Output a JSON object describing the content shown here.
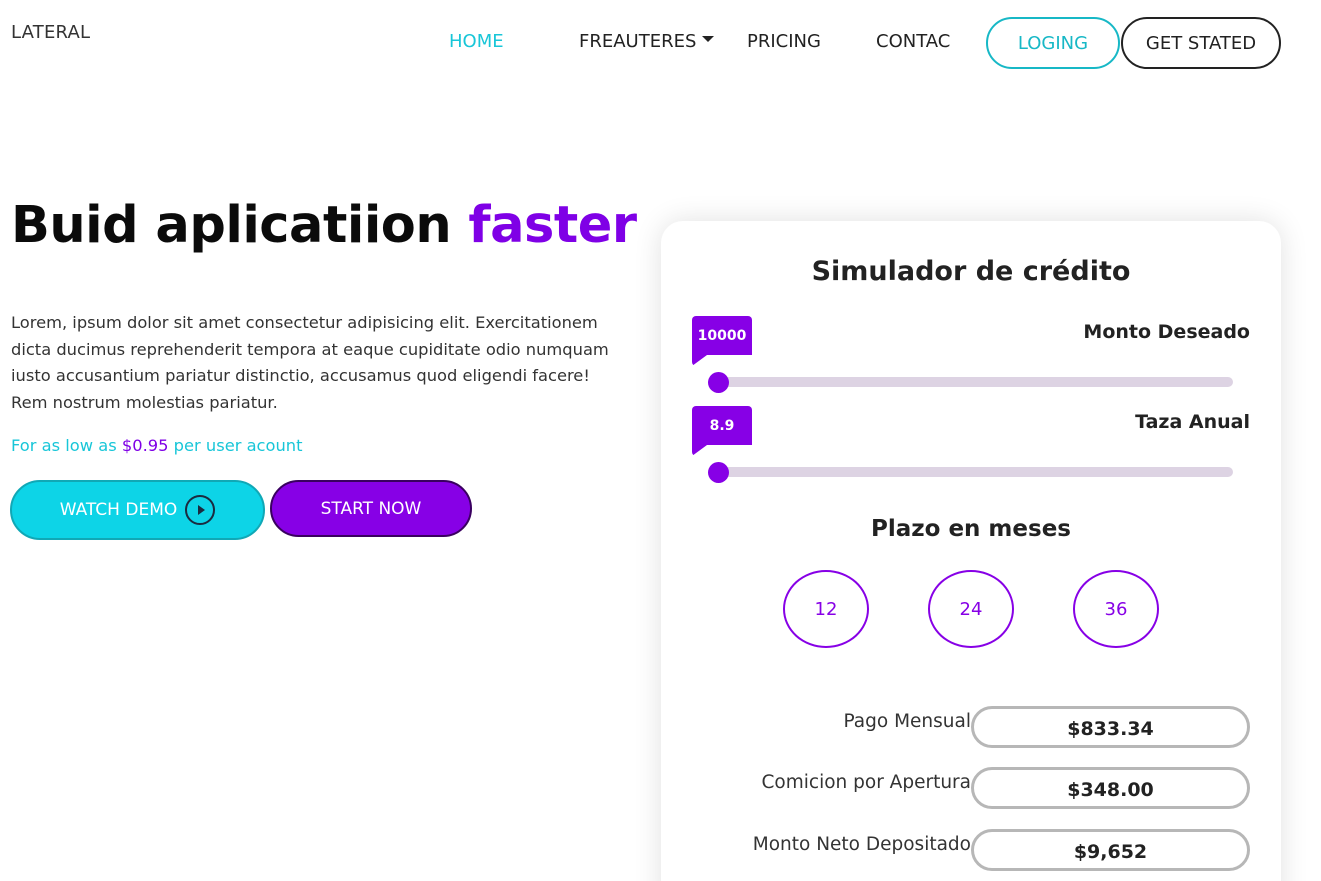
{
  "nav": {
    "brand": "LATERAL",
    "links": [
      "HOME",
      "FREAUTERES",
      "PRICING",
      "CONTAC"
    ],
    "login": "LOGING",
    "get_started": "GET STATED"
  },
  "hero": {
    "title_main": "Buid aplicatiion ",
    "title_accent": "faster",
    "description": "Lorem, ipsum dolor sit amet consectetur adipisicing elit. Exercitationem dicta ducimus reprehenderit tempora at eaque cupiditate odio numquam iusto accusantium pariatur distinctio, accusamus quod eligendi facere! Rem nostrum molestias pariatur.",
    "price_prefix": "For as low as ",
    "price_amount": "$0.95",
    "price_suffix": " per user acount",
    "watch_demo": "WATCH DEMO",
    "start_now": "START NOW"
  },
  "simulator": {
    "title": "Simulador de crédito",
    "amount_label": "Monto Deseado",
    "amount_value": "10000",
    "amount_position": 0,
    "rate_label": "Taza Anual",
    "rate_value": "8.9",
    "rate_position": 0,
    "term_title": "Plazo en meses",
    "terms": [
      "12",
      "24",
      "36"
    ],
    "results": [
      {
        "label": "Pago Mensual",
        "value": "$833.34"
      },
      {
        "label": "Comicion por Apertura",
        "value": "$348.00"
      },
      {
        "label": "Monto Neto Depositado",
        "value": "$9,652"
      }
    ]
  },
  "colors": {
    "accent_purple": "#8700e6",
    "accent_cyan": "#0dd4e7"
  }
}
